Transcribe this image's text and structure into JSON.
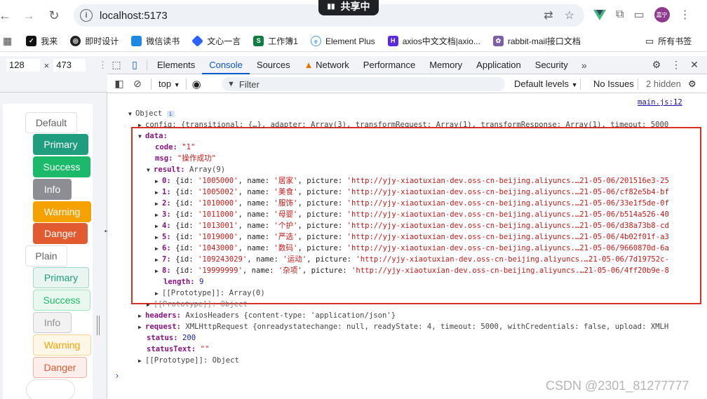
{
  "browser": {
    "url": "localhost:5173",
    "share_label": "共享中",
    "avatar_text": "嘉宁"
  },
  "bookmarks": [
    {
      "label": "我来",
      "icon": "woilai-icon",
      "color": "#111111"
    },
    {
      "label": "即时设计",
      "icon": "js-design-icon",
      "color": "#222222"
    },
    {
      "label": "微信读书",
      "icon": "weread-icon",
      "color": "#1e88e5"
    },
    {
      "label": "文心一言",
      "icon": "wenxin-icon",
      "color": "#2962ff"
    },
    {
      "label": "工作簿1",
      "icon": "sheet-icon",
      "color": "#107c41"
    },
    {
      "label": "Element Plus",
      "icon": "element-icon",
      "color": "#409eff"
    },
    {
      "label": "axios中文文档|axio...",
      "icon": "axios-icon",
      "color": "#5a29e4"
    },
    {
      "label": "rabbit-mail接口文档",
      "icon": "rabbit-icon",
      "color": "#7b5ea7"
    }
  ],
  "bookmarks_all": "所有书签",
  "dimensions": {
    "width": "128",
    "height": "473"
  },
  "page_buttons": [
    {
      "label": "Default",
      "bg": "#ffffff",
      "fg": "#606266",
      "border": "#dcdfe6"
    },
    {
      "label": "Primary",
      "bg": "#1e9e7e",
      "fg": "#ffffff",
      "border": "#1e9e7e"
    },
    {
      "label": "Success",
      "bg": "#1bb96a",
      "fg": "#ffffff",
      "border": "#1bb96a"
    },
    {
      "label": "Info",
      "bg": "#8c8e93",
      "fg": "#ffffff",
      "border": "#8c8e93"
    },
    {
      "label": "Warning",
      "bg": "#f5a200",
      "fg": "#ffffff",
      "border": "#f5a200"
    },
    {
      "label": "Danger",
      "bg": "#e25a2f",
      "fg": "#ffffff",
      "border": "#e25a2f"
    },
    {
      "label": "Plain",
      "bg": "#ffffff",
      "fg": "#606266",
      "border": "#dcdfe6"
    },
    {
      "label": "Primary",
      "bg": "#e8f5f1",
      "fg": "#1e9e7e",
      "border": "#9fd6c4"
    },
    {
      "label": "Success",
      "bg": "#e8f8ef",
      "fg": "#1bb96a",
      "border": "#a3e2bf"
    },
    {
      "label": "Info",
      "bg": "#f2f2f3",
      "fg": "#8c8e93",
      "border": "#cbcccf"
    },
    {
      "label": "Warning",
      "bg": "#fef6e6",
      "fg": "#f5a200",
      "border": "#f8d68c"
    },
    {
      "label": "Danger",
      "bg": "#fcefeb",
      "fg": "#e25a2f",
      "border": "#f0b2a0"
    }
  ],
  "devtools": {
    "tabs": [
      "Elements",
      "Console",
      "Sources",
      "Network",
      "Performance",
      "Memory",
      "Application",
      "Security"
    ],
    "active_tab": "Console",
    "context": "top",
    "filter_placeholder": "Filter",
    "levels": "Default levels",
    "issues": "No Issues",
    "hidden": "2 hidden",
    "source_link": "main.js:12"
  },
  "console": {
    "object_label": "Object",
    "config_line": "config: {transitional: {…}, adapter: Array(3), transformRequest: Array(1), transformResponse: Array(1), timeout: 5000",
    "data_key": "data:",
    "code_key": "code:",
    "code_val": "\"1\"",
    "msg_key": "msg:",
    "msg_val": "\"操作成功\"",
    "result_key": "result:",
    "result_type": "Array(9)",
    "items": [
      {
        "idx": "0:",
        "id": "'1005000'",
        "name": "'居家'",
        "pic": "'http://yjy-xiaotuxian-dev.oss-cn-beijing.aliyuncs.…21-05-06/201516e3-25"
      },
      {
        "idx": "1:",
        "id": "'1005002'",
        "name": "'美食'",
        "pic": "'http://yjy-xiaotuxian-dev.oss-cn-beijing.aliyuncs.…21-05-06/cf82e5b4-bf"
      },
      {
        "idx": "2:",
        "id": "'1010000'",
        "name": "'服饰'",
        "pic": "'http://yjy-xiaotuxian-dev.oss-cn-beijing.aliyuncs.…21-05-06/33e1f5de-0f"
      },
      {
        "idx": "3:",
        "id": "'1011000'",
        "name": "'母婴'",
        "pic": "'http://yjy-xiaotuxian-dev.oss-cn-beijing.aliyuncs.…21-05-06/b514a526-40"
      },
      {
        "idx": "4:",
        "id": "'1013001'",
        "name": "'个护'",
        "pic": "'http://yjy-xiaotuxian-dev.oss-cn-beijing.aliyuncs.…21-05-06/d38a73b8-cd"
      },
      {
        "idx": "5:",
        "id": "'1019000'",
        "name": "'严选'",
        "pic": "'http://yjy-xiaotuxian-dev.oss-cn-beijing.aliyuncs.…21-05-06/4b02f01f-a3"
      },
      {
        "idx": "6:",
        "id": "'1043000'",
        "name": "'数码'",
        "pic": "'http://yjy-xiaotuxian-dev.oss-cn-beijing.aliyuncs.…21-05-06/9660870d-6a"
      },
      {
        "idx": "7:",
        "id": "'109243029'",
        "name": "'运动'",
        "pic": "'http://yjy-xiaotuxian-dev.oss-cn-beijing.aliyuncs.…21-05-06/7d19752c-"
      },
      {
        "idx": "8:",
        "id": "'19999999'",
        "name": "'杂项'",
        "pic": "'http://yjy-xiaotuxian-dev.oss-cn-beijing.aliyuncs.…21-05-06/4ff20b9e-8"
      }
    ],
    "length_key": "length:",
    "length_val": "9",
    "proto_array": "[[Prototype]]: Array(0)",
    "proto_object_inner": "[[Prototype]]: Object",
    "headers_key": "headers:",
    "headers_val": "AxiosHeaders {content-type: 'application/json'}",
    "request_key": "request:",
    "request_val": "XMLHttpRequest {onreadystatechange: null, readyState: 4, timeout: 5000, withCredentials: false, upload: XMLH",
    "status_key": "status:",
    "status_val": "200",
    "statusText_key": "statusText:",
    "statusText_val": "\"\"",
    "proto_object": "[[Prototype]]: Object"
  },
  "watermark": "CSDN @2301_81277777"
}
